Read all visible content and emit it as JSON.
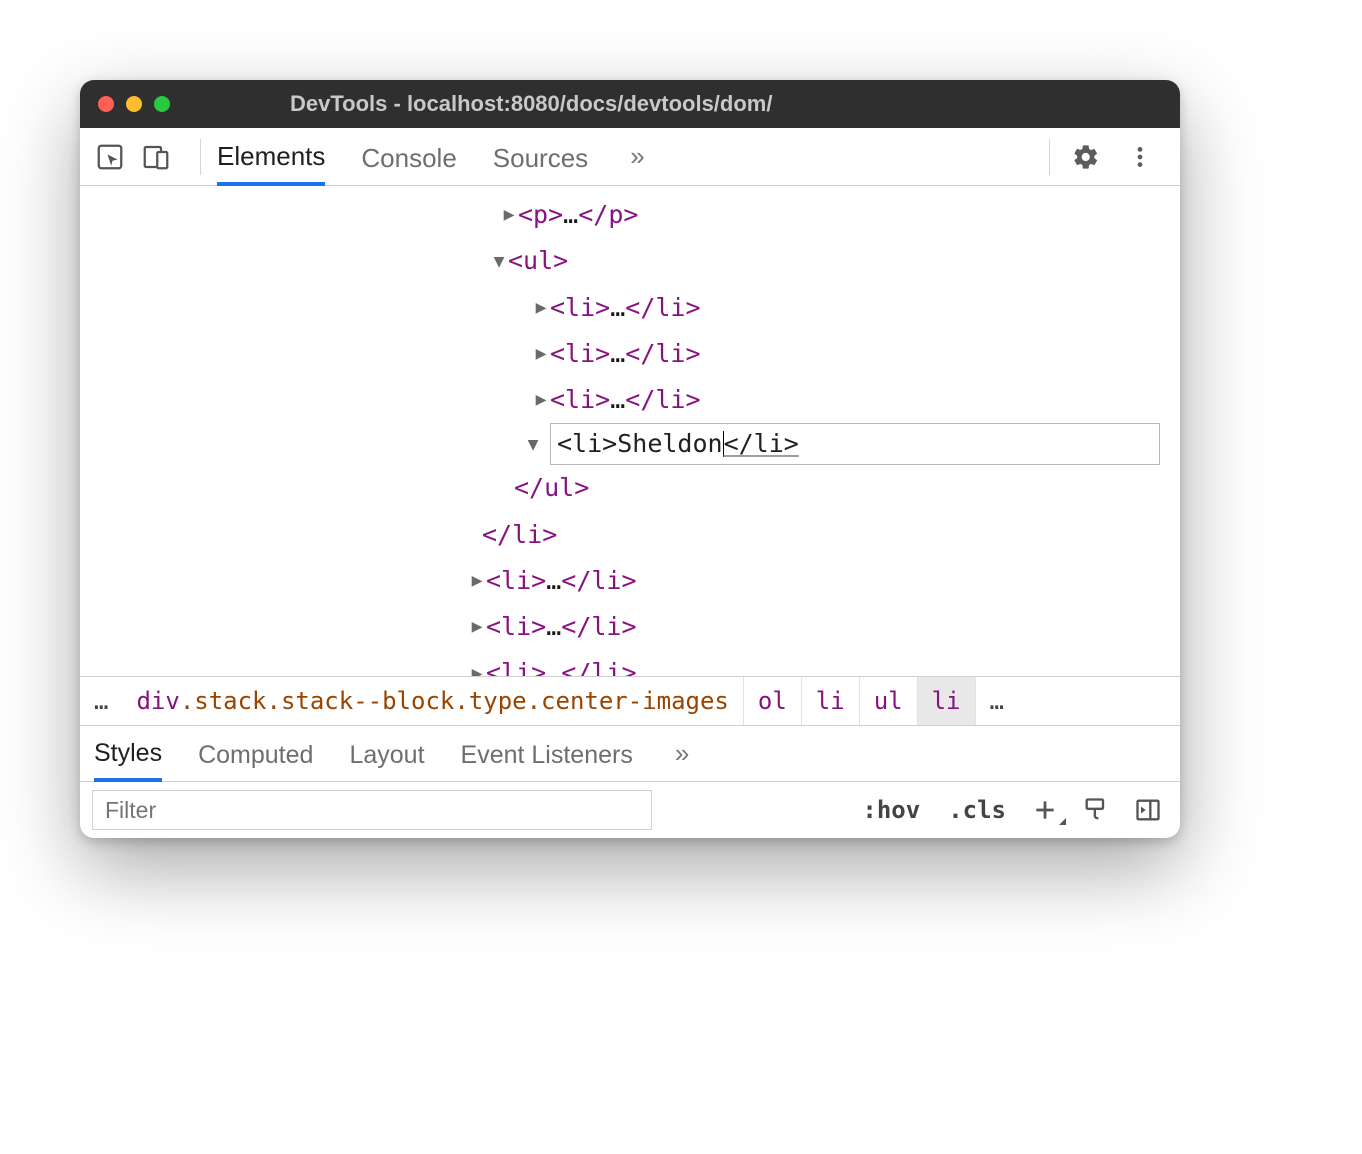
{
  "window": {
    "title": "DevTools - localhost:8080/docs/devtools/dom/"
  },
  "topTabs": {
    "elements": "Elements",
    "console": "Console",
    "sources": "Sources"
  },
  "dom": {
    "p_open": "<p>",
    "p_close": "</p>",
    "ul_open": "<ul>",
    "ul_close": "</ul>",
    "li_row": {
      "open": "<li>",
      "mid": "…",
      "close": "</li>"
    },
    "edit_open": "<li>",
    "edit_text": "Sheldon",
    "edit_close_pre": "</li",
    "edit_close_gt": ">",
    "close_li": "</li>"
  },
  "breadcrumb": {
    "ellipsis": "…",
    "div": "div",
    "classes": ".stack.stack--block.type.center-images",
    "ol": "ol",
    "li1": "li",
    "ul": "ul",
    "li2": "li"
  },
  "stylesTabs": {
    "styles": "Styles",
    "computed": "Computed",
    "layout": "Layout",
    "events": "Event Listeners"
  },
  "stylesToolbar": {
    "filterPlaceholder": "Filter",
    "hov": ":hov",
    "cls": ".cls"
  }
}
